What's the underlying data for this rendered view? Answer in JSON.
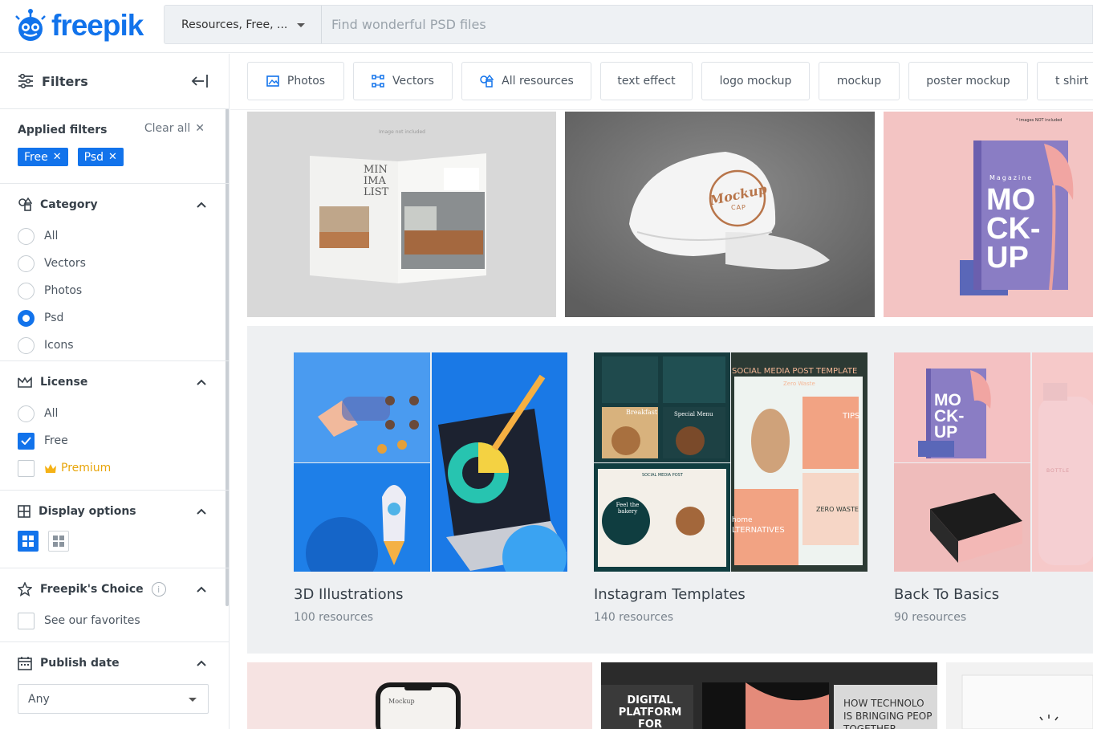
{
  "header": {
    "logo_text": "freepik",
    "brand_color": "#1273eb",
    "search_scope": "Resources, Free, ...",
    "search_placeholder": "Find wonderful PSD files"
  },
  "sidebar": {
    "title": "Filters",
    "applied_label": "Applied filters",
    "clear_all": "Clear all",
    "applied_tags": [
      "Free",
      "Psd"
    ],
    "category": {
      "title": "Category",
      "options": [
        "All",
        "Vectors",
        "Photos",
        "Psd",
        "Icons"
      ],
      "selected": "Psd"
    },
    "license": {
      "title": "License",
      "all": "All",
      "free": "Free",
      "premium": "Premium"
    },
    "display": {
      "title": "Display options"
    },
    "choice": {
      "title": "Freepik's Choice",
      "favorites": "See our favorites"
    },
    "publish": {
      "title": "Publish date",
      "value": "Any"
    }
  },
  "chips": [
    "Photos",
    "Vectors",
    "All resources",
    "text effect",
    "logo mockup",
    "mockup",
    "poster mockup",
    "t shirt m"
  ],
  "images": {
    "magazine_text": "MIN IMA LIST",
    "magazine_note": "Image not included",
    "cap_text_1": "Mockup",
    "cap_text_2": "CAP",
    "book_label": "Magazine",
    "book_lines": [
      "MO",
      "CK-",
      "UP"
    ],
    "book_note": "* images NOT included"
  },
  "collections": [
    {
      "title": "3D Illustrations",
      "count": "100 resources"
    },
    {
      "title": "Instagram Templates",
      "count": "140 resources"
    },
    {
      "title": "Back To Basics",
      "count": "90 resources"
    }
  ],
  "insta": {
    "banner": "SOCIAL MEDIA POST TEMPLATE",
    "sub": "Zero Waste",
    "tips": "TIPS",
    "zero": "ZERO WASTE",
    "home": "home",
    "alt": "LTERNATIVES",
    "breakfast": "Breakfast",
    "special": "Special Menu",
    "feel": "Feel the bakery",
    "social": "SOCIAL MEDIA POST"
  },
  "basics": {
    "book_lines": [
      "MO",
      "CK-",
      "UP"
    ],
    "bottle": "BOTTLE"
  },
  "bottom_row": {
    "phone_text": "Mockup",
    "digital_lines": [
      "DIGITAL",
      "PLATFORM",
      "FOR EVERYONE"
    ],
    "tech_lines": [
      "HOW TECHNOLO",
      "IS BRINGING PEOP",
      "TOGETHER"
    ]
  }
}
